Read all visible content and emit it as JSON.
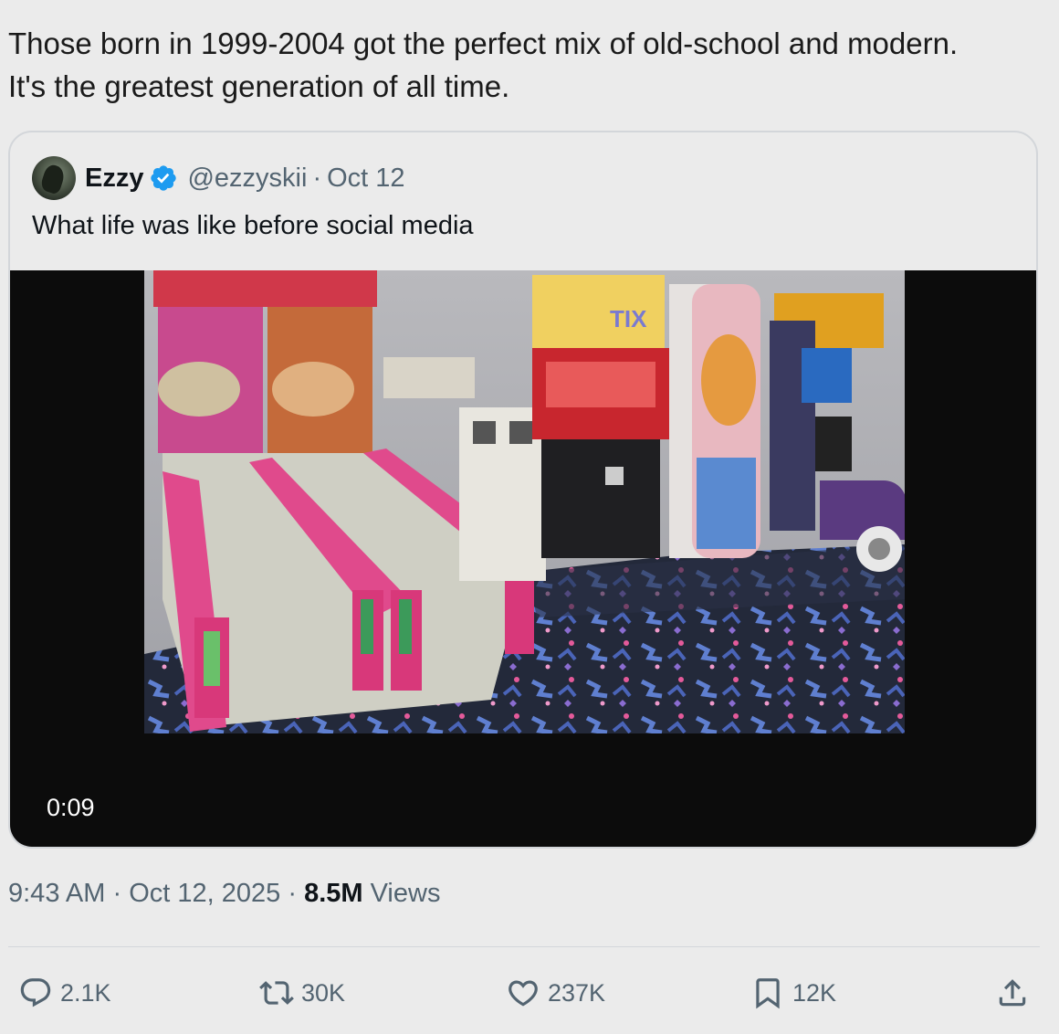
{
  "tweet": {
    "text_line1": "Those born in 1999-2004 got the perfect mix of old-school and modern.",
    "text_line2": "It's the greatest generation of all time."
  },
  "quote": {
    "author_name": "Ezzy",
    "handle": "@ezzyskii",
    "separator": "·",
    "date": "Oct 12",
    "text": "What life was like before social media",
    "video_duration": "0:09",
    "arcade_sign_text": "TIX"
  },
  "meta": {
    "time": "9:43 AM",
    "separator": "·",
    "date": "Oct 12, 2025",
    "views_count": "8.5M",
    "views_label": "Views"
  },
  "actions": {
    "replies": "2.1K",
    "reposts": "30K",
    "likes": "237K",
    "bookmarks": "12K"
  },
  "colors": {
    "background": "#ebebeb",
    "text_primary": "#0f1419",
    "text_secondary": "#536471",
    "verified_blue": "#1d9bf0",
    "border": "#d3d6da"
  },
  "icons": [
    "verified-icon",
    "reply-icon",
    "repost-icon",
    "like-icon",
    "bookmark-icon",
    "share-icon"
  ]
}
